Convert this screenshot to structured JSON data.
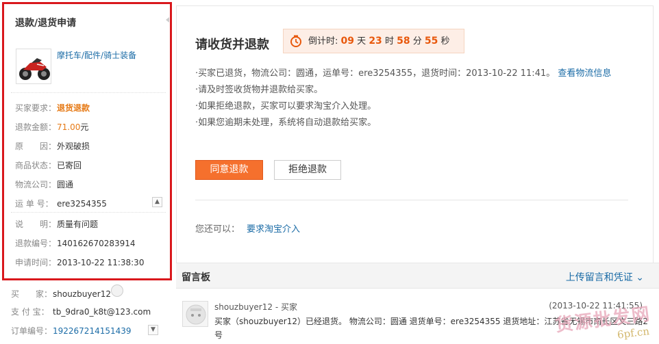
{
  "sidebar": {
    "title": "退款/退货申请",
    "product_name": "摩托车/配件/骑士装备",
    "rows": [
      {
        "label": "买家要求：",
        "value": "退货退款"
      },
      {
        "label": "退款金额：",
        "value": "71.00",
        "unit": "元"
      },
      {
        "label": "原　　因：",
        "value": "外观破损"
      },
      {
        "label": "商品状态：",
        "value": "已寄回"
      },
      {
        "label": "物流公司：",
        "value": "圆通"
      },
      {
        "label": "运 单 号：",
        "value": "ere3254355"
      },
      {
        "label": "说　　明：",
        "value": "质量有问题"
      },
      {
        "label": "退款编号：",
        "value": "140162670283914"
      },
      {
        "label": "申请时间：",
        "value": "2013-10-22 11:38:30"
      }
    ],
    "buyer_rows": [
      {
        "label": "买　　家：",
        "value": "shouzbuyer12"
      },
      {
        "label": "支 付 宝：",
        "value": "tb_9dra0_k8t@123.com"
      },
      {
        "label": "订单编号：",
        "value": "192267214151439"
      }
    ]
  },
  "main": {
    "status_title": "请收货并退款",
    "countdown": {
      "prefix": "倒计时:",
      "days": "09",
      "days_unit": "天",
      "hours": "23",
      "hours_unit": "时",
      "minutes": "58",
      "minutes_unit": "分",
      "seconds": "55",
      "seconds_unit": "秒"
    },
    "notes": [
      "·买家已退货，物流公司：圆通，运单号：ere3254355，退货时间：2013-10-22 11:41。",
      "·请及时签收货物并退款给买家。",
      "·如果拒绝退款，买家可以要求淘宝介入处理。",
      "·如果您逾期未处理，系统将自动退款给买家。"
    ],
    "logistics_link": "查看物流信息",
    "agree_button": "同意退款",
    "refuse_button": "拒绝退款",
    "also_label": "您还可以：",
    "also_link": "要求淘宝介入"
  },
  "message_board": {
    "title": "留言板",
    "upload_link": "上传留言和凭证",
    "message": {
      "author": "shouzbuyer12 - 买家",
      "time": "(2013-10-22 11:41:55)",
      "text": "买家（shouzbuyer12）已经退货。 物流公司：圆通 退货单号：ere3254355 退货地址：江苏省无锡市南长区文三路2号"
    }
  },
  "watermark": {
    "line1": "货源批发网",
    "line2": "6pf.cn"
  },
  "colors": {
    "accent_red": "#d9171c",
    "orange": "#f5702d",
    "link_blue": "#1a6ba6",
    "countdown_bg": "#fdeee6"
  }
}
